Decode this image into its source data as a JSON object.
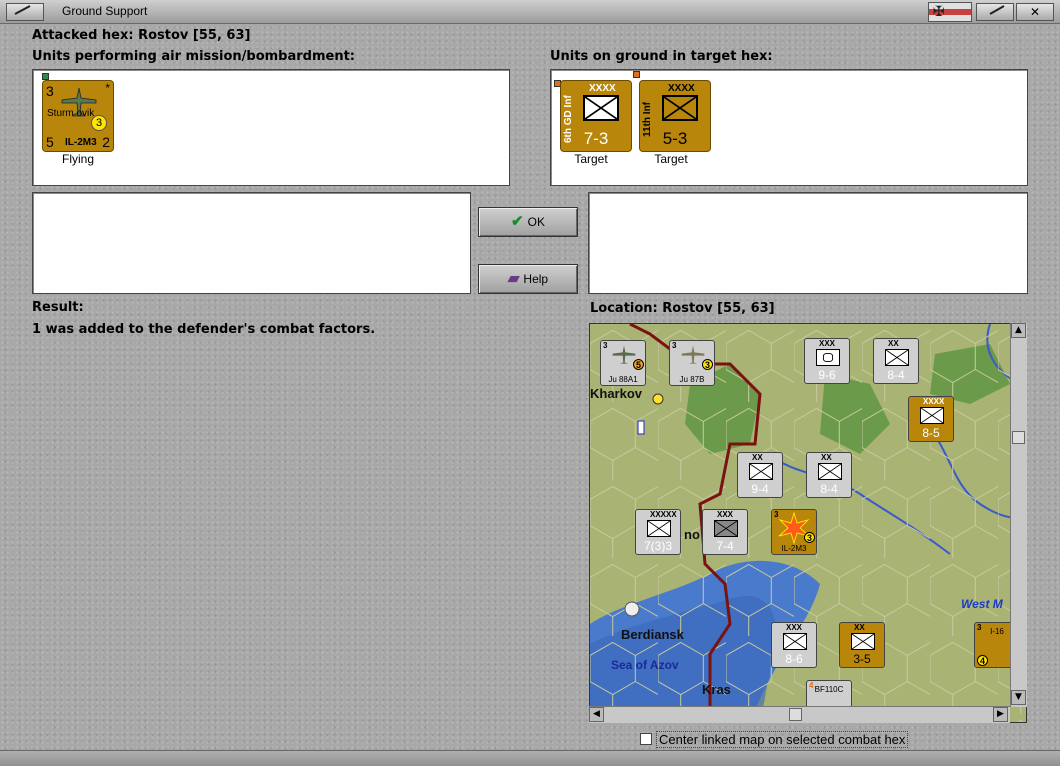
{
  "window": {
    "title": "Ground Support",
    "close_glyph": "✕",
    "flag_glyph": "✠"
  },
  "attacked_hex": "Attacked hex: Rostov  [55, 63]",
  "attackers_panel": {
    "label": "Units performing air mission/bombardment:",
    "units": [
      {
        "tl": "3",
        "tr": "*",
        "bl": "5",
        "br": "2",
        "name": "Sturm ovik",
        "model": "IL-2M3",
        "badge": "3",
        "caption": "Flying"
      }
    ]
  },
  "defenders_panel": {
    "label": "Units on ground in target hex:",
    "units": [
      {
        "rot": "6th GD Inf",
        "size": "XXXX",
        "strength": "7-3",
        "caption": "Target"
      },
      {
        "rot": "11th Inf",
        "size": "XXXX",
        "strength": "5-3",
        "caption": "Target"
      }
    ]
  },
  "buttons": {
    "ok": "OK",
    "help": "Help"
  },
  "result": {
    "label": "Result:",
    "text": "1 was added to the defender's combat factors."
  },
  "location": {
    "label": "Location:  Rostov  [55, 63]",
    "map_labels": {
      "kharkov": "Kharkov",
      "berdiansk": "Berdiansk",
      "sea": "Sea of Azov",
      "kras": "Kras",
      "west": "West M",
      "no": "no"
    },
    "map_units": {
      "u1": {
        "str": "9-6",
        "size": "XXX"
      },
      "u2": {
        "str": "8-4",
        "size": "XX"
      },
      "u3": {
        "str": "8-5",
        "size": "XXXX"
      },
      "u4": {
        "str": "9-4",
        "size": "XX"
      },
      "u5": {
        "str": "8-4",
        "size": "XX"
      },
      "u6": {
        "str": "7(3)3",
        "size": "XXXXX"
      },
      "u7": {
        "str": "7-4",
        "size": "XXX"
      },
      "u8": {
        "str": "8-6",
        "size": "XXX"
      },
      "u9": {
        "str": "3-5",
        "size": "XX"
      },
      "u10": {
        "str": "Ju 88A1",
        "tl": "3",
        "badge": "5"
      },
      "u11": {
        "str": "Ju 87B",
        "tl": "3",
        "badge": "3"
      },
      "u12": {
        "str": "IL-2M3",
        "tl": "3",
        "badge": "3"
      },
      "u13": {
        "str": "BF110C",
        "tl": "4"
      },
      "u14": {
        "str": "I-16",
        "tl": "3",
        "badge": "4"
      }
    }
  },
  "center_option": {
    "label": "Center linked map on selected combat hex",
    "checked": false
  }
}
